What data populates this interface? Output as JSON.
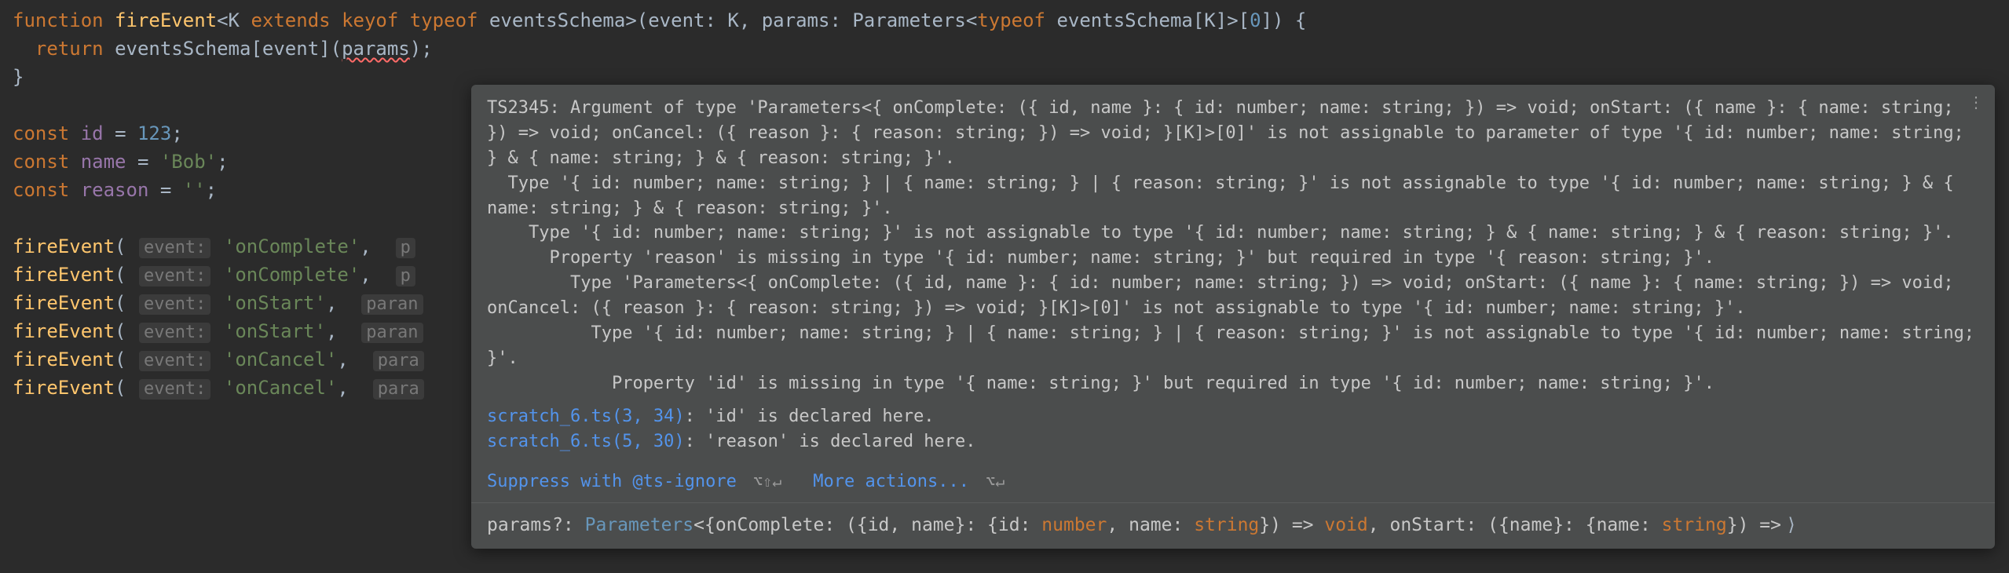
{
  "code": {
    "l1": {
      "kw_function": "function",
      "fn": "fireEvent",
      "generic_open": "<",
      "K": "K",
      "kw_extends": "extends",
      "kw_keyof": "keyof",
      "kw_typeof": "typeof",
      "eventsSchema": "eventsSchema",
      "generic_close": ">",
      "paren_open": "(",
      "event_param": "event",
      "colon1": ":",
      "K2": "K",
      "comma": ",",
      "params_param": "params",
      "colon2": ":",
      "Parameters": "Parameters",
      "lt2": "<",
      "kw_typeof2": "typeof",
      "eventsSchema2": "eventsSchema",
      "brk_open": "[",
      "K3": "K",
      "brk_close": "]",
      "gt2": ">",
      "brk2_open": "[",
      "zero": "0",
      "brk2_close": "]",
      "paren_close": ")",
      "brace_open": "{"
    },
    "l2": {
      "kw_return": "return",
      "eventsSchema": "eventsSchema",
      "brk_open": "[",
      "event": "event",
      "brk_close": "]",
      "paren_open": "(",
      "params": "params",
      "paren_close": ")",
      "semi": ";"
    },
    "l3": {
      "brace_close": "}"
    },
    "l5": {
      "kw_const": "const",
      "id": "id",
      "eq": "=",
      "num": "123",
      "semi": ";"
    },
    "l6": {
      "kw_const": "const",
      "id": "name",
      "eq": "=",
      "str": "'Bob'",
      "semi": ";"
    },
    "l7": {
      "kw_const": "const",
      "id": "reason",
      "eq": "=",
      "str": "''",
      "semi": ";"
    },
    "hints": {
      "event": "event:",
      "params_p": "p",
      "params_para": "para",
      "params_paran": "paran"
    },
    "calls": [
      {
        "label": "'onComplete'",
        "phint": "p"
      },
      {
        "label": "'onComplete'",
        "phint": "p"
      },
      {
        "label": "'onStart'",
        "phint": "paran"
      },
      {
        "label": "'onStart'",
        "phint": "paran"
      },
      {
        "label": "'onCancel'",
        "phint": "para"
      },
      {
        "label": "'onCancel'",
        "phint": "para"
      }
    ],
    "fireEvent_call": "fireEvent"
  },
  "tooltip": {
    "error_code": "TS2345:",
    "body": "TS2345: Argument of type 'Parameters<{ onComplete: ({ id, name }: { id: number; name: string; }) => void; onStart: ({ name }: { name: string; }) => void; onCancel: ({ reason }: { reason: string; }) => void; }[K]>[0]' is not assignable to parameter of type '{ id: number; name: string; } & { name: string; } & { reason: string; }'.\n  Type '{ id: number; name: string; } | { name: string; } | { reason: string; }' is not assignable to type '{ id: number; name: string; } & { name: string; } & { reason: string; }'.\n    Type '{ id: number; name: string; }' is not assignable to type '{ id: number; name: string; } & { name: string; } & { reason: string; }'.\n      Property 'reason' is missing in type '{ id: number; name: string; }' but required in type '{ reason: string; }'.\n        Type 'Parameters<{ onComplete: ({ id, name }: { id: number; name: string; }) => void; onStart: ({ name }: { name: string; }) => void; onCancel: ({ reason }: { reason: string; }) => void; }[K]>[0]' is not assignable to type '{ id: number; name: string; }'.\n          Type '{ id: number; name: string; } | { name: string; } | { reason: string; }' is not assignable to type '{ id: number; name: string; }'.\n            Property 'id' is missing in type '{ name: string; }' but required in type '{ id: number; name: string; }'.",
    "link1_file": "scratch_6.ts(3, 34)",
    "link1_rest": ": 'id' is declared here.",
    "link2_file": "scratch_6.ts(5, 30)",
    "link2_rest": ": 'reason' is declared here.",
    "suppress": "Suppress with @ts-ignore",
    "suppress_shortcut": "⌥⇧↵",
    "more_actions": "More actions...",
    "more_shortcut": "⌥↵",
    "sig": {
      "params_label": "params?:",
      "Parameters": "Parameters",
      "onComplete": "onComplete",
      "id": "id",
      "name": "name",
      "number": "number",
      "string": "string",
      "void": "void",
      "onStart": "onStart",
      "raw": "params?: Parameters<{onComplete: ({id, name}: {id: number, name: string}) => void, onStart: ({name}: {name: string}) =>"
    }
  }
}
